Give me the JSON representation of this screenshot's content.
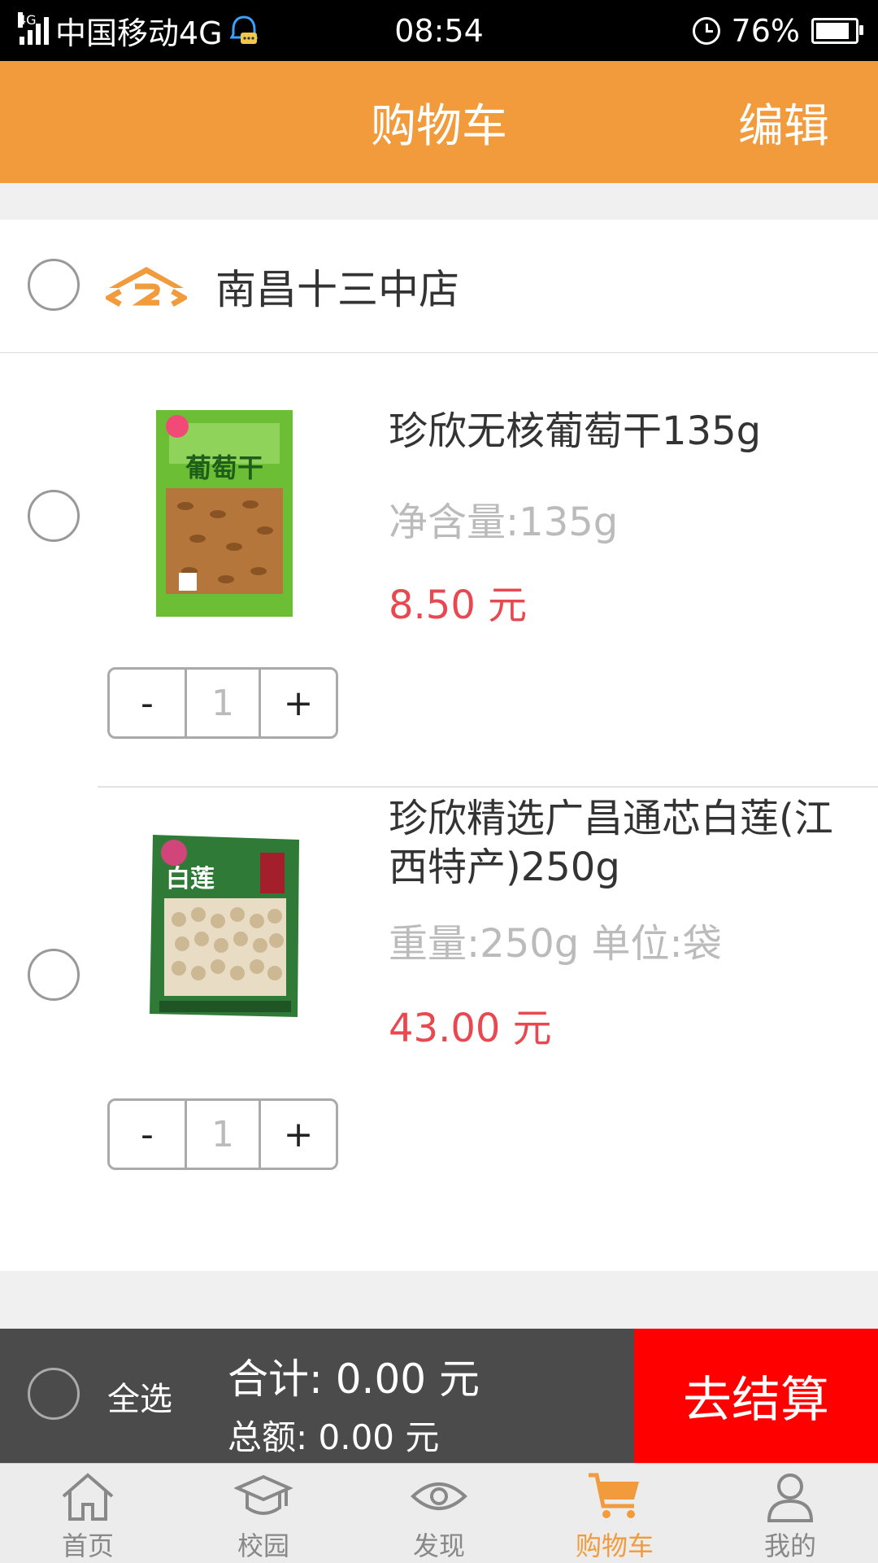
{
  "status_bar": {
    "network_tag": "4G",
    "carrier": "中国移动4G",
    "time": "08:54",
    "battery": "76%",
    "battery_level": 0.76
  },
  "header": {
    "title": "购物车",
    "edit_label": "编辑"
  },
  "store": {
    "name": "南昌十三中店"
  },
  "items": [
    {
      "name": "珍欣无核葡萄干135g",
      "spec": "净含量:135g",
      "price": "8.50 元",
      "image_text": "葡萄干",
      "minus": "-",
      "quantity": "1",
      "plus": "+"
    },
    {
      "name": "珍欣精选广昌通芯白莲(江西特产)250g",
      "spec": "重量:250g 单位:袋",
      "price": "43.00 元",
      "image_text": "白莲",
      "minus": "-",
      "quantity": "1",
      "plus": "+"
    }
  ],
  "checkout": {
    "select_all": "全选",
    "subtotal": "合计:  0.00 元",
    "total": "总额:  0.00 元",
    "pay_label": "去结算"
  },
  "tabs": [
    {
      "label": "首页",
      "icon": "home-icon"
    },
    {
      "label": "校园",
      "icon": "campus-icon"
    },
    {
      "label": "发现",
      "icon": "eye-icon"
    },
    {
      "label": "购物车",
      "icon": "cart-icon",
      "active": true
    },
    {
      "label": "我的",
      "icon": "user-icon"
    }
  ],
  "colors": {
    "brand": "#f19b3c",
    "price": "#e8484f",
    "pay": "#ff0000"
  }
}
